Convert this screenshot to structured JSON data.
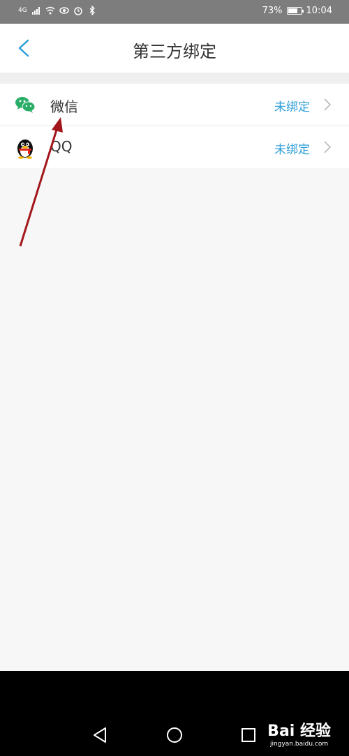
{
  "status_bar": {
    "network": "4G",
    "battery": "73%",
    "battery_level": 0.73,
    "time": "10:04"
  },
  "header": {
    "title": "第三方绑定",
    "back_icon": "chevron-left-icon",
    "accent_color": "#2d9fd8"
  },
  "accounts": [
    {
      "label": "微信",
      "status": "未绑定",
      "icon": "wechat-icon",
      "icon_color": "#2aae67"
    },
    {
      "label": "QQ",
      "status": "未绑定",
      "icon": "qq-penguin-icon",
      "icon_color": "#000000"
    }
  ],
  "annotation": {
    "color": "#a3171c"
  },
  "nav": {
    "buttons": [
      "back-triangle-icon",
      "home-circle-icon",
      "recents-square-icon"
    ]
  },
  "watermark": {
    "brand": "Bai 经验",
    "site": "jingyan.baidu.com"
  }
}
